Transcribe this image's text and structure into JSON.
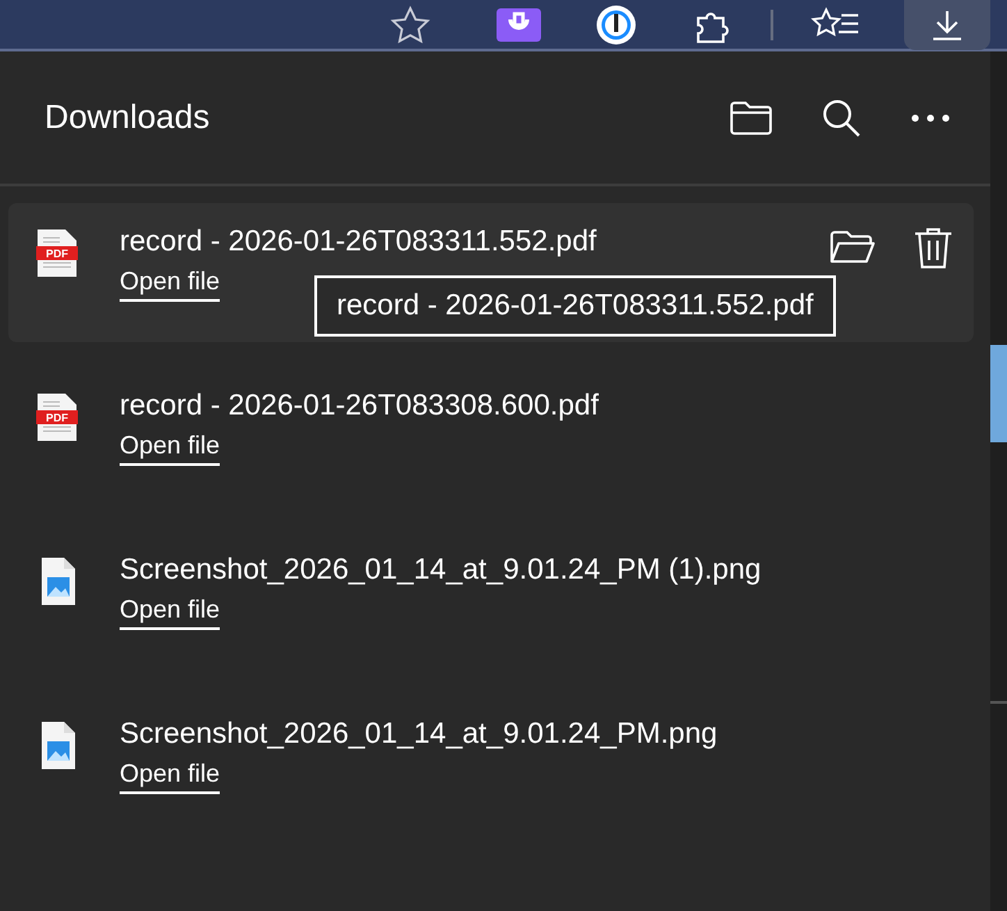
{
  "panel": {
    "title": "Downloads"
  },
  "items": [
    {
      "name": "record - 2026-01-26T083311.552.pdf",
      "kind": "pdf",
      "badge": "PDF",
      "action": "Open file",
      "hovered": true
    },
    {
      "name": "record - 2026-01-26T083308.600.pdf",
      "kind": "pdf",
      "badge": "PDF",
      "action": "Open file",
      "hovered": false
    },
    {
      "name": "Screenshot_2026_01_14_at_9.01.24_PM (1).png",
      "kind": "image",
      "action": "Open file",
      "hovered": false
    },
    {
      "name": "Screenshot_2026_01_14_at_9.01.24_PM.png",
      "kind": "image",
      "action": "Open file",
      "hovered": false
    }
  ],
  "tooltip": "record - 2026-01-26T083311.552.pdf"
}
